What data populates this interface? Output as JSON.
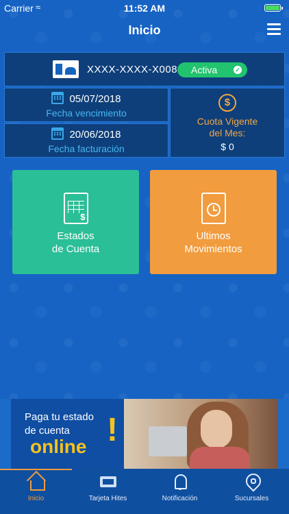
{
  "status_bar": {
    "carrier": "Carrier",
    "time": "11:52 AM"
  },
  "nav": {
    "title": "Inicio"
  },
  "card": {
    "brand": "hites",
    "number": "XXXX-XXXX-X008",
    "status": "Activa"
  },
  "dates": {
    "due_date": "05/07/2018",
    "due_label": "Fecha vencimiento",
    "billing_date": "20/06/2018",
    "billing_label": "Fecha facturación"
  },
  "quota": {
    "label": "Cuota Vigente del Mes:",
    "value": "$ 0"
  },
  "tiles": {
    "statements": {
      "line1": "Estados",
      "line2": "de Cuenta"
    },
    "movements": {
      "line1": "Ultimos",
      "line2": "Movimientos"
    }
  },
  "promo": {
    "line1": "Paga tu estado",
    "line2": "de cuenta",
    "highlight": "online",
    "bang": "!"
  },
  "tabs": [
    {
      "label": "Inicio",
      "icon": "home-icon",
      "active": true
    },
    {
      "label": "Tarjeta Hites",
      "icon": "card-icon"
    },
    {
      "label": "Notificación",
      "icon": "bell-icon"
    },
    {
      "label": "Sucursales",
      "icon": "location-pin-icon"
    }
  ],
  "colors": {
    "background": "#1663c4",
    "panel": "#0e3f7a",
    "active_badge": "#22c36e",
    "accent_orange": "#f19c3e",
    "accent_teal": "#2bbf97",
    "label_blue": "#46b7f3",
    "promo_yellow": "#f7c21d"
  }
}
